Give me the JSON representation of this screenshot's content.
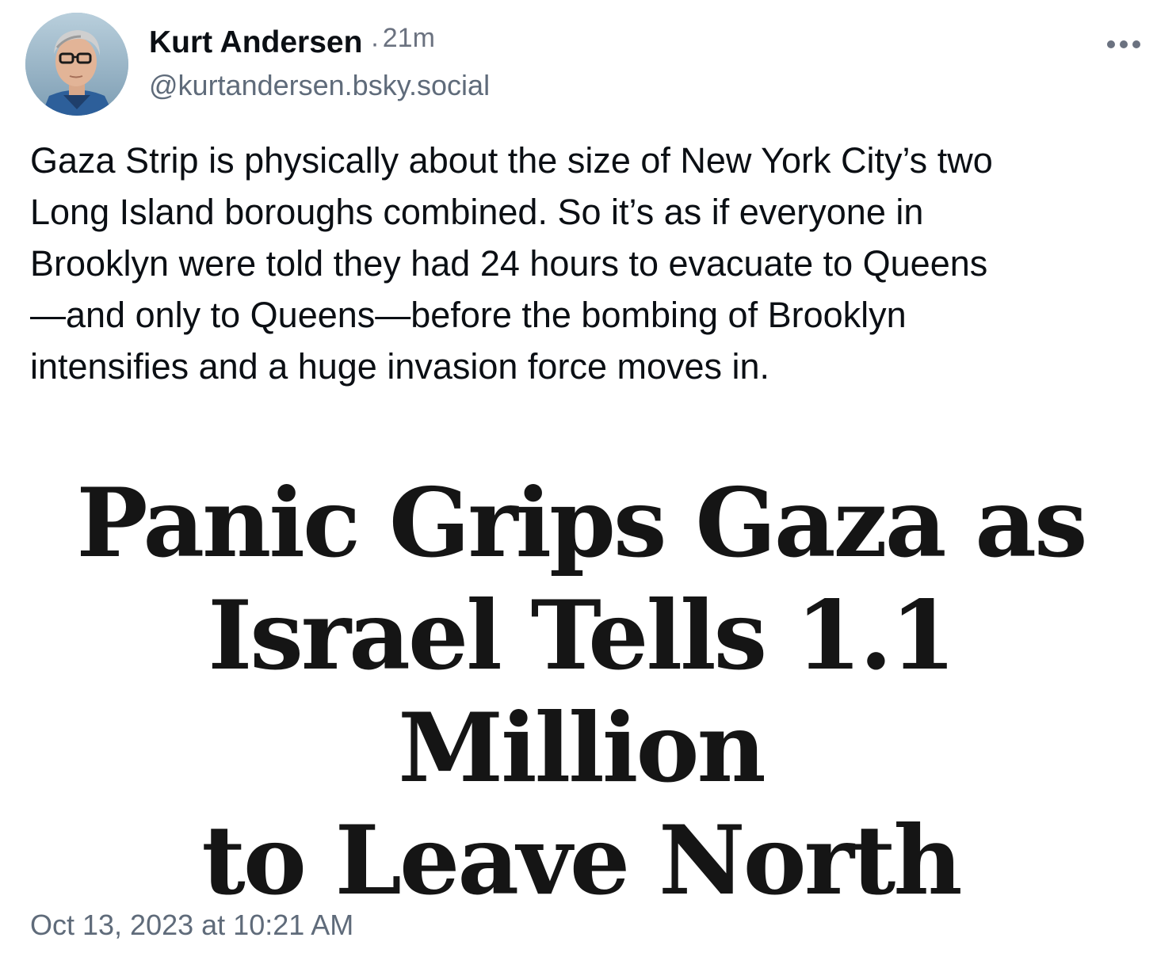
{
  "author": {
    "display_name": "Kurt Andersen",
    "separator": "·",
    "time_ago": "21m",
    "handle": "@kurtandersen.bsky.social",
    "avatar_icon": "user-avatar-photo"
  },
  "menu": {
    "icon": "more-horizontal-icon"
  },
  "post": {
    "text": "Gaza Strip is physically about the size of New York City’s two\nLong Island boroughs combined. So it’s as if everyone in\nBrooklyn were told they had 24 hours to evacuate to Queens\n—and only to Queens—before the bombing of Brooklyn\nintensifies and a huge invasion force moves in.",
    "timestamp": "Oct 13, 2023 at 10:21 AM"
  },
  "embed": {
    "headline_lines": [
      "Panic Grips Gaza as",
      "Israel Tells 1.1 Million",
      "to Leave North"
    ]
  },
  "colors": {
    "text_primary": "#0b0f14",
    "text_secondary": "#5f6b7a",
    "background": "#ffffff"
  }
}
